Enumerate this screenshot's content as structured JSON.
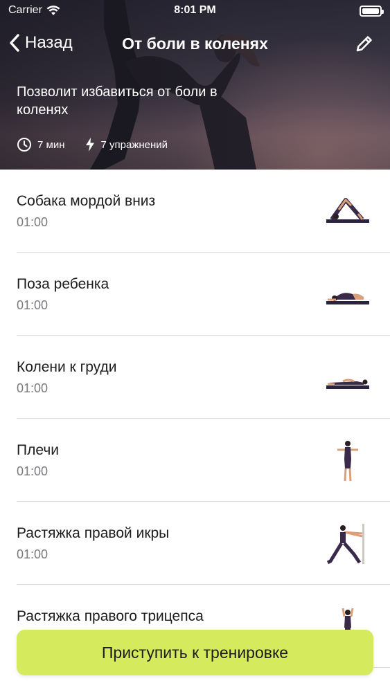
{
  "status_bar": {
    "carrier": "Carrier",
    "time": "8:01 PM"
  },
  "nav": {
    "back_label": "Назад",
    "title": "От боли в коленях"
  },
  "hero": {
    "description": "Позволит избавиться от боли в коленях",
    "duration": "7 мин",
    "exercises_count": "7 упражнений"
  },
  "exercises": [
    {
      "name": "Собака мордой вниз",
      "duration": "01:00",
      "icon": "downward-dog-pose-icon"
    },
    {
      "name": "Поза ребенка",
      "duration": "01:00",
      "icon": "child-pose-icon"
    },
    {
      "name": "Колени к груди",
      "duration": "01:00",
      "icon": "knees-to-chest-pose-icon"
    },
    {
      "name": "Плечи",
      "duration": "01:00",
      "icon": "shoulders-stretch-icon"
    },
    {
      "name": "Растяжка правой икры",
      "duration": "01:00",
      "icon": "calf-stretch-icon"
    },
    {
      "name": "Растяжка правого трицепса",
      "duration": "",
      "icon": "triceps-stretch-icon"
    }
  ],
  "cta": {
    "label": "Приступить к тренировке"
  },
  "colors": {
    "accent": "#d5ea5d",
    "text": "#1c1c1e",
    "secondary_text": "#7a7a80"
  }
}
